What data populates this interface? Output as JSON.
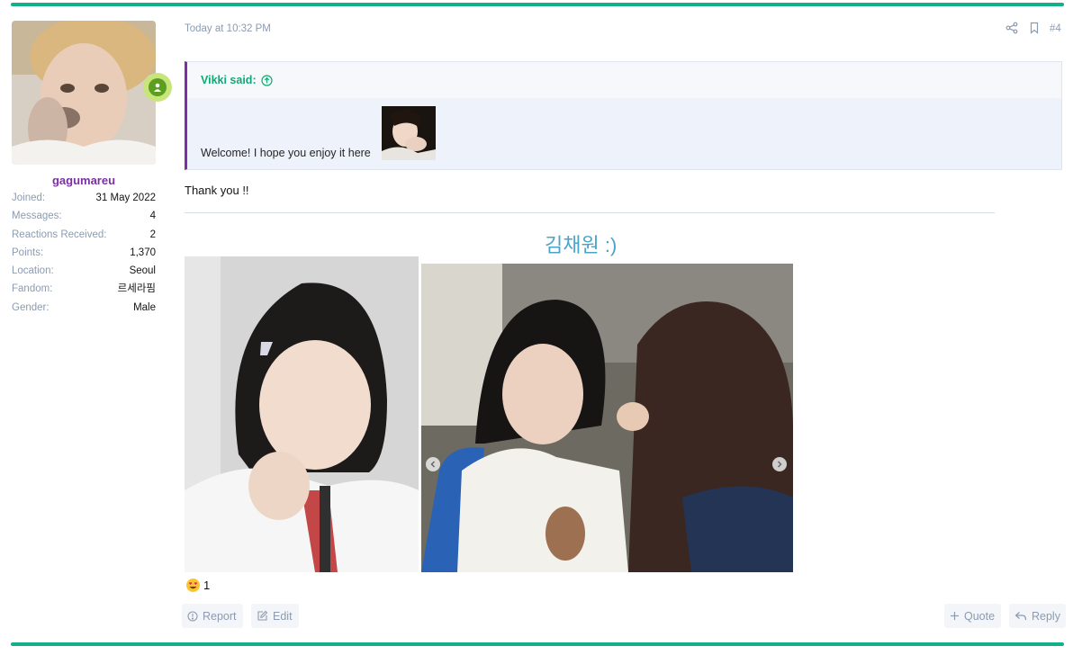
{
  "user": {
    "name": "gagumareu",
    "stats": [
      {
        "label": "Joined:",
        "value": "31 May 2022"
      },
      {
        "label": "Messages:",
        "value": "4"
      },
      {
        "label": "Reactions Received:",
        "value": "2"
      },
      {
        "label": "Points:",
        "value": "1,370"
      },
      {
        "label": "Location:",
        "value": "Seoul"
      },
      {
        "label": "Fandom:",
        "value": "르세라핌"
      },
      {
        "label": "Gender:",
        "value": "Male"
      }
    ]
  },
  "post": {
    "date": "Today at 10:32 PM",
    "number": "#4",
    "quote": {
      "author_label": "Vikki said:",
      "text": "Welcome! I hope you enjoy it here"
    },
    "body": "Thank you !!",
    "title": "김채원 :)",
    "reaction_count": "1"
  },
  "actions": {
    "report": "Report",
    "edit": "Edit",
    "quote": "Quote",
    "reply": "Reply"
  },
  "colors": {
    "accent": "#12b08a",
    "username": "#7b2fa5",
    "title": "#4aa3c8"
  }
}
